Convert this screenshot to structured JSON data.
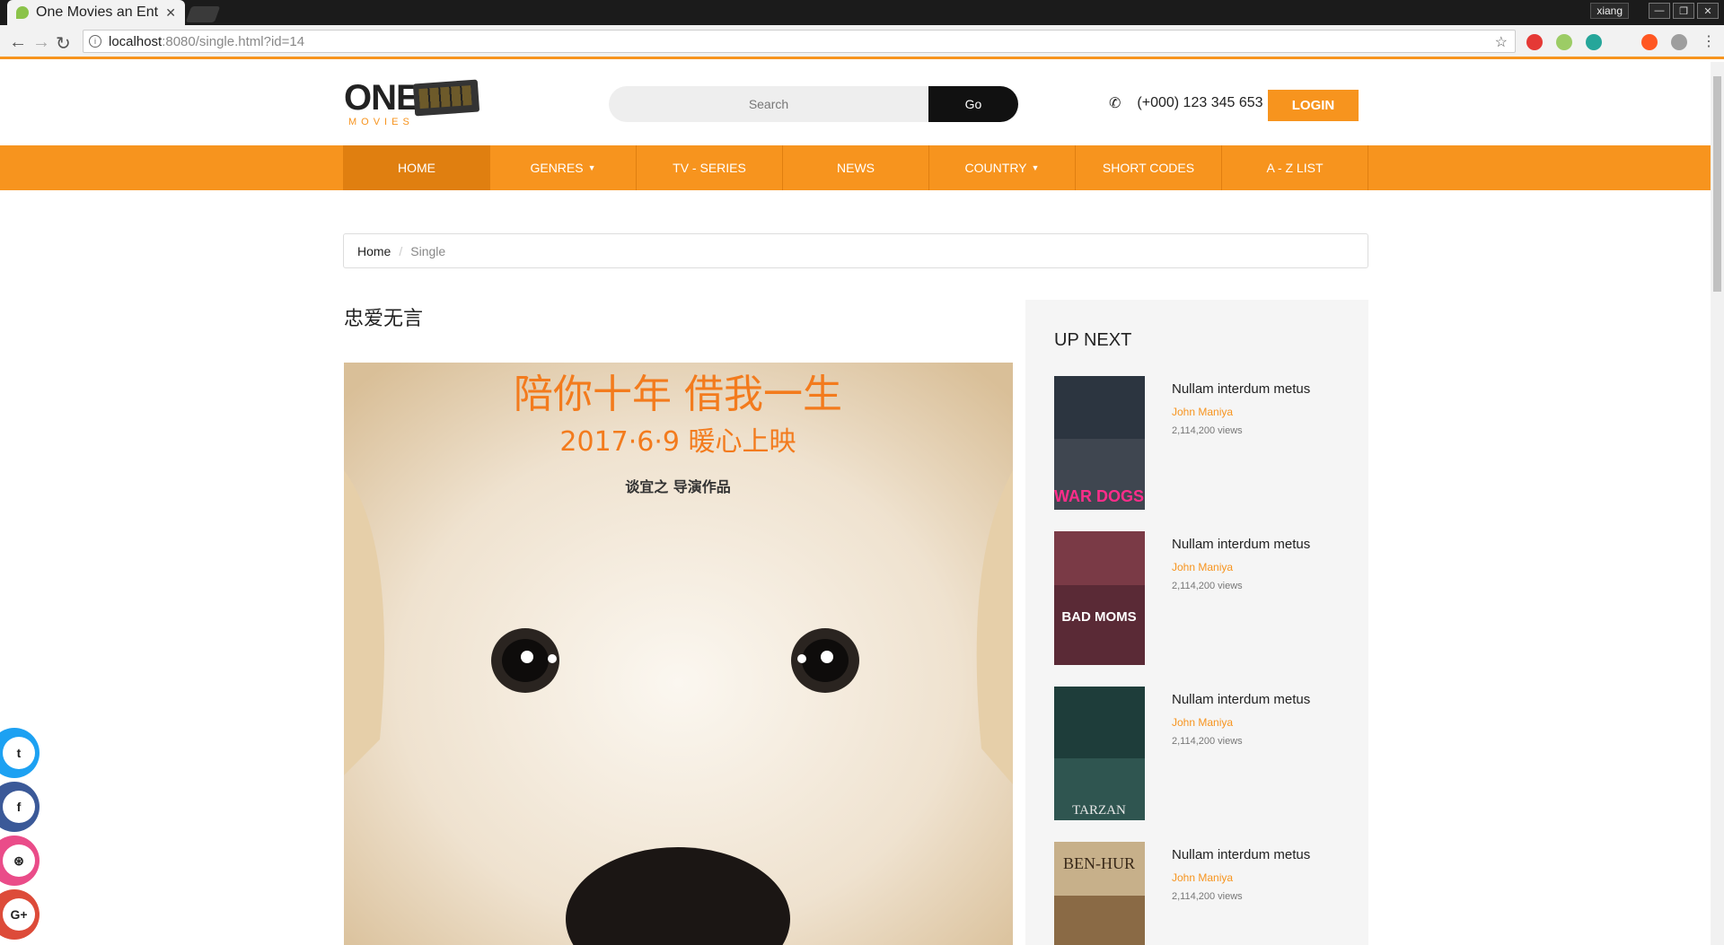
{
  "browser": {
    "tab_title": "One Movies an Ent",
    "tab_close": "✕",
    "user": "xiang",
    "url_host": "localhost",
    "url_rest": ":8080/single.html?id=14"
  },
  "header": {
    "logo_main": "ONE",
    "logo_sub": "MOVIES",
    "search_placeholder": "Search",
    "search_button": "Go",
    "phone": "(+000) 123 345 653",
    "login": "LOGIN"
  },
  "nav": {
    "items": [
      {
        "label": "HOME"
      },
      {
        "label": "GENRES"
      },
      {
        "label": "TV - SERIES"
      },
      {
        "label": "NEWS"
      },
      {
        "label": "COUNTRY"
      },
      {
        "label": "SHORT CODES"
      },
      {
        "label": "A - Z LIST"
      }
    ]
  },
  "breadcrumb": {
    "home": "Home",
    "current": "Single"
  },
  "movie": {
    "title": "忠爱无言",
    "poster_line1": "陪你十年  借我一生",
    "poster_line2": "2017·6·9 暖心上映",
    "poster_line3": "谈宜之  导演作品"
  },
  "sidebar": {
    "heading": "UP NEXT",
    "items": [
      {
        "name": "Nullam interdum metus",
        "author": "John Maniya",
        "views": "2,114,200 views",
        "poster_text": "WAR DOGS"
      },
      {
        "name": "Nullam interdum metus",
        "author": "John Maniya",
        "views": "2,114,200 views",
        "poster_text": "BAD MOMS"
      },
      {
        "name": "Nullam interdum metus",
        "author": "John Maniya",
        "views": "2,114,200 views",
        "poster_text": "TARZAN"
      },
      {
        "name": "Nullam interdum metus",
        "author": "John Maniya",
        "views": "2,114,200 views",
        "poster_text": "BEN-HUR"
      }
    ]
  },
  "social": [
    {
      "icon": "twitter-icon",
      "glyph": "t",
      "color": "#1da1f2"
    },
    {
      "icon": "facebook-icon",
      "glyph": "f",
      "color": "#3b5998"
    },
    {
      "icon": "dribbble-icon",
      "glyph": "⊛",
      "color": "#ea4c89"
    },
    {
      "icon": "google-plus-icon",
      "glyph": "G+",
      "color": "#dd4b39"
    }
  ],
  "colors": {
    "accent": "#f7941e",
    "accent_dark": "#e07f10"
  }
}
